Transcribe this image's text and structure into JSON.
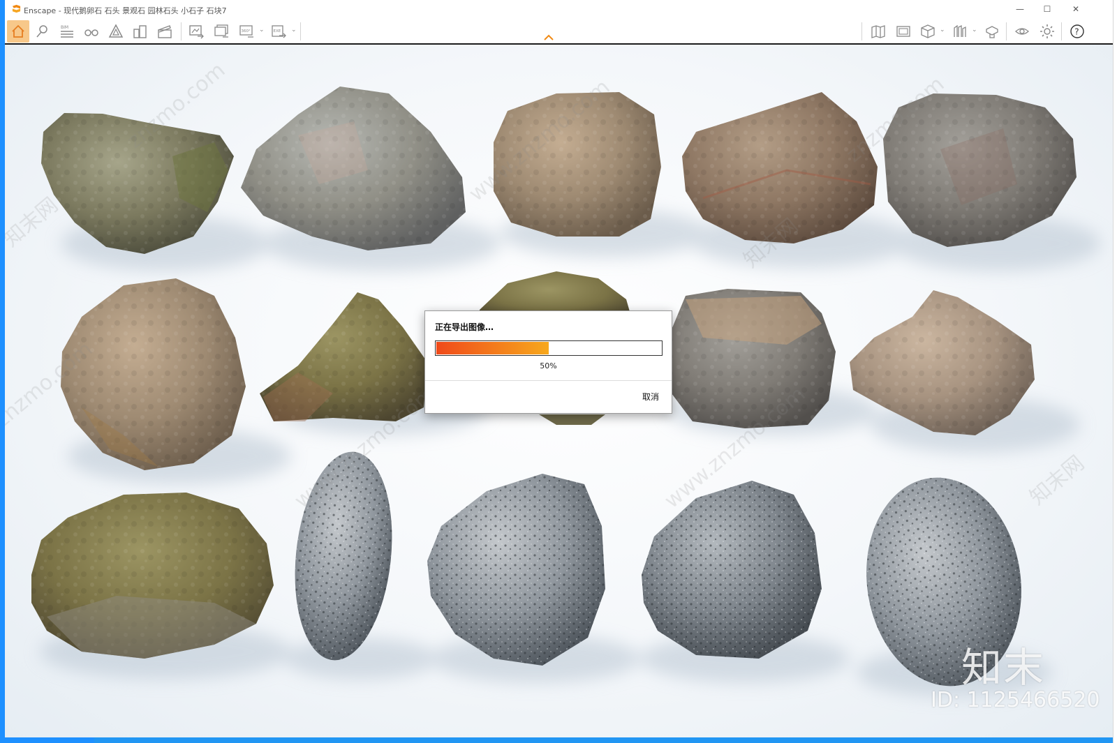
{
  "window": {
    "app_name": "Enscape",
    "title": "Enscape - 现代鹅卵石 石头 景观石 园林石头 小石子 石块7",
    "controls": {
      "minimize": "—",
      "maximize": "☐",
      "close": "✕"
    }
  },
  "toolbar": {
    "left_icons": [
      "home-icon",
      "location-pin-icon",
      "bim-icon",
      "binoculars-icon",
      "perspective-icon",
      "buildings-icon",
      "clapperboard-icon",
      "screenshot-icon",
      "batch-render-icon",
      "panorama-360-icon",
      "export-exe-icon"
    ],
    "bim_label": "BIM",
    "pano_label": "360°",
    "exe_label": "EXE",
    "right_icons": [
      "map-icon",
      "gallery-icon",
      "asset-cube-icon",
      "library-icon",
      "materials-icon",
      "visibility-eye-icon",
      "settings-gear-icon",
      "help-icon"
    ],
    "help_label": "?"
  },
  "viewport": {
    "watermarks": [
      "znzmo.com",
      "知末网",
      "www.znzmo.com"
    ],
    "brand_logo": "知末",
    "brand_id": "ID: 1125466520"
  },
  "dialog": {
    "title": "正在导出图像…",
    "progress": 0.5,
    "progress_label": "50%",
    "cancel_label": "取消",
    "fill_colors": [
      "#f04a1a",
      "#f7a81c"
    ]
  }
}
